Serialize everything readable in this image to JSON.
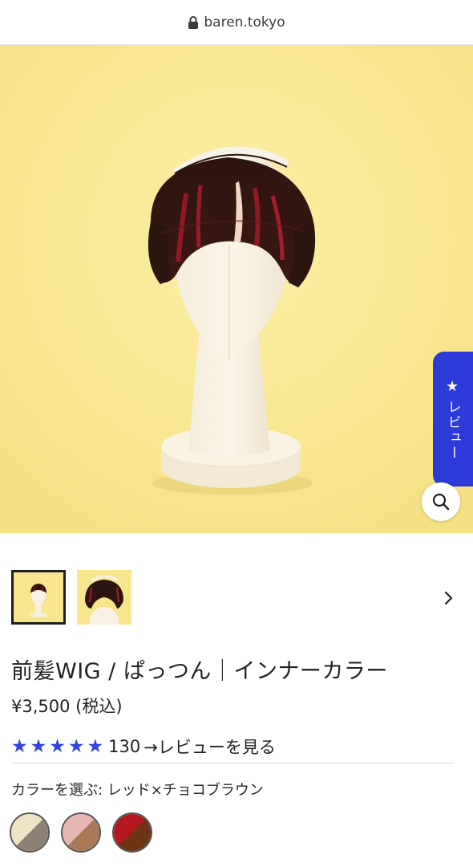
{
  "browser": {
    "url": "baren.tokyo"
  },
  "product": {
    "title": "前髪WIG / ぱっつん｜インナーカラー",
    "price": "¥3,500 (税込)",
    "rating": {
      "stars": 5,
      "count": "130",
      "link_label": "→レビューを見る"
    },
    "color_label": "カラーを選ぶ: レッド×チョコブラウン",
    "swatches": [
      {
        "top": "#ece4c4",
        "bottom": "#8d8175"
      },
      {
        "top": "#e6b6b2",
        "bottom": "#a87a5a"
      },
      {
        "top": "#b3161c",
        "bottom": "#6b3516"
      }
    ],
    "thumbnail_count": 2
  },
  "review_tab": {
    "star": "★",
    "label": "レビュー"
  },
  "icons": {
    "lock": "lock-icon",
    "zoom": "search-icon",
    "next": "chevron-right-icon",
    "star": "star-icon"
  },
  "colors": {
    "accent": "#2b3ad8",
    "hero_bg": "#f8e68e",
    "star": "#3344e0"
  }
}
